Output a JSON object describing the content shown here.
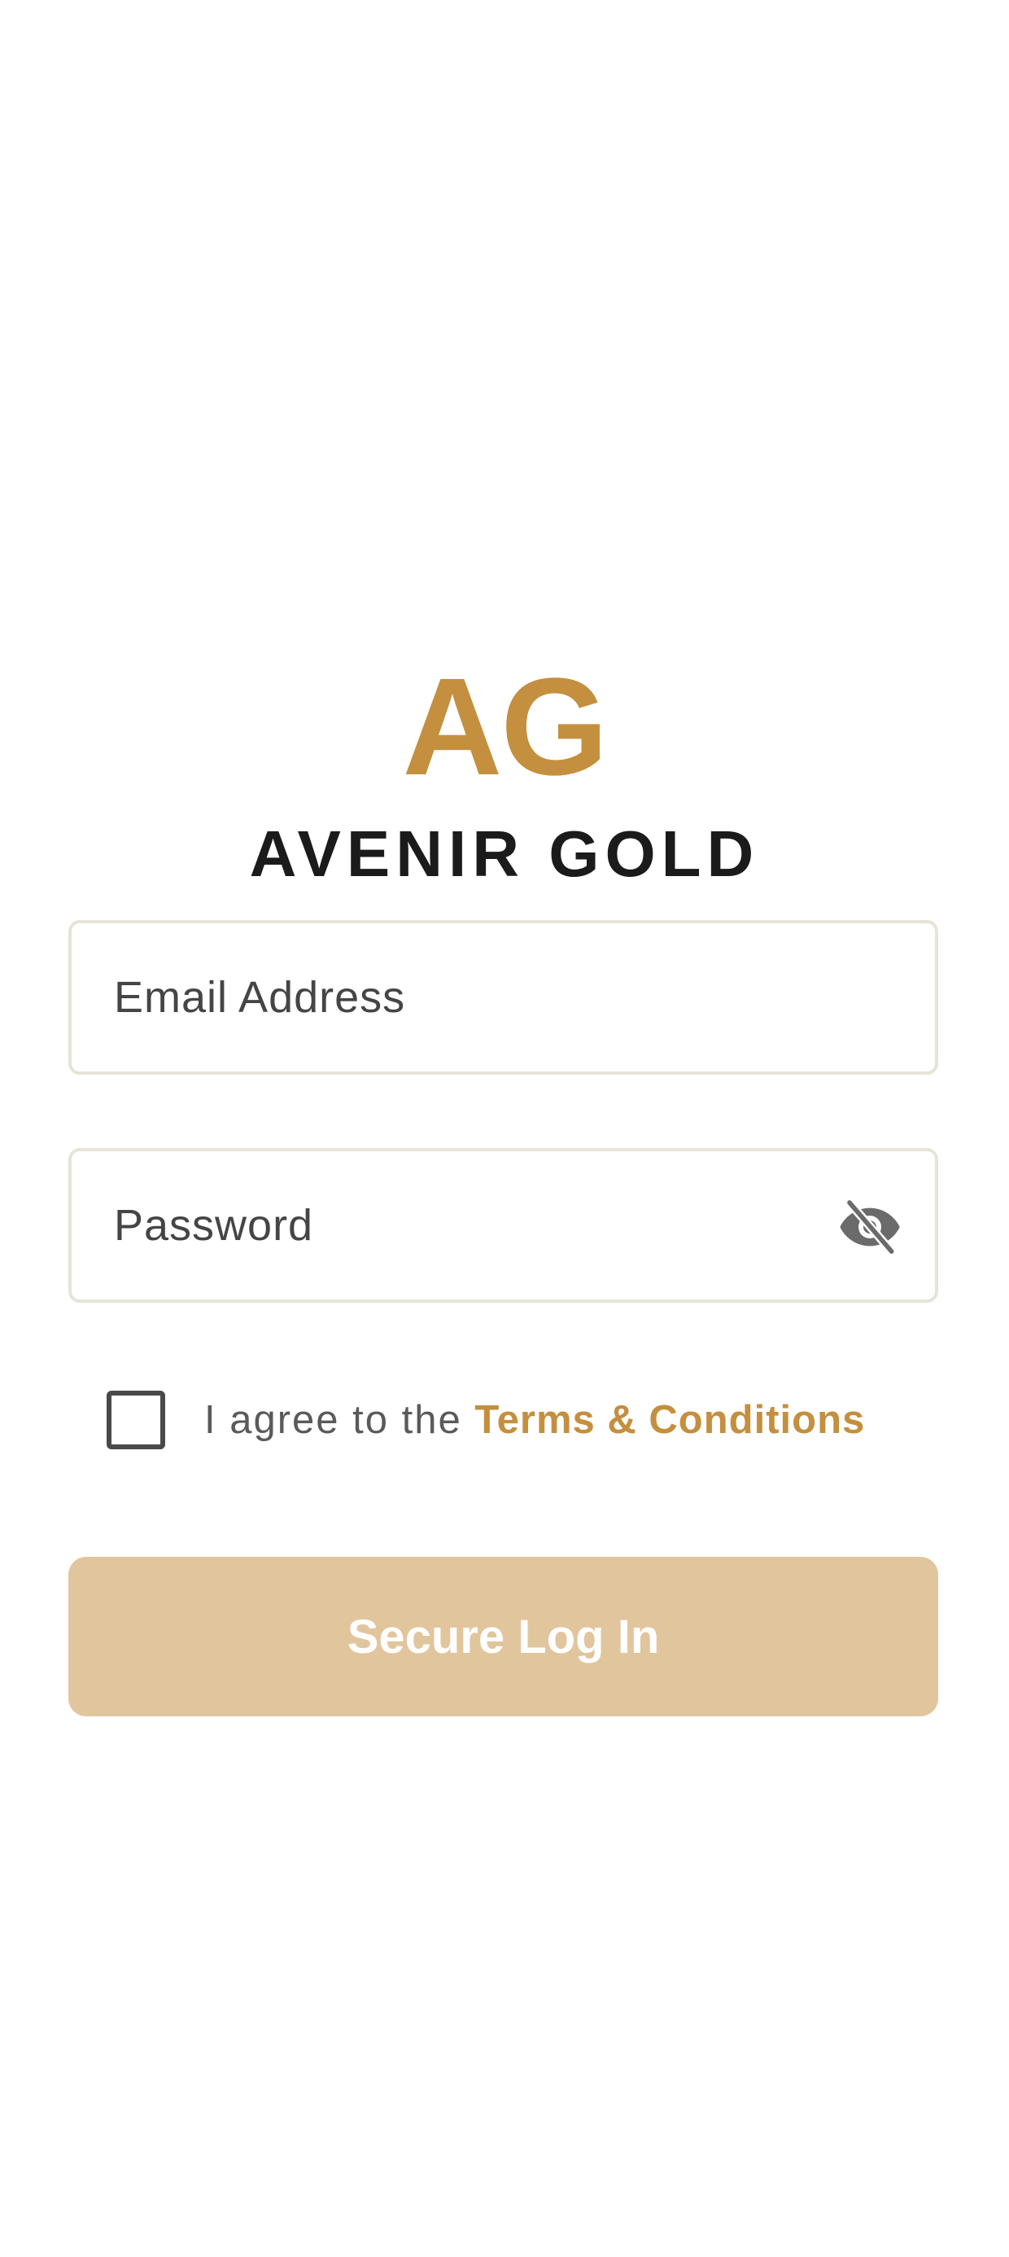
{
  "brand": {
    "logo_mark": "AG",
    "name": "AVENIR GOLD"
  },
  "form": {
    "email_placeholder": "Email Address",
    "password_placeholder": "Password",
    "password_toggle_icon": "eye-off-icon",
    "agree_prefix": "I agree to the ",
    "terms_link": "Terms & Conditions",
    "agree_checked": false,
    "submit_label": "Secure Log In"
  },
  "colors": {
    "accent_gold": "#c48f3e",
    "button_gold_disabled": "#e1c59d",
    "field_border": "#e6e3d8",
    "brand_text": "#1b1b1b"
  }
}
